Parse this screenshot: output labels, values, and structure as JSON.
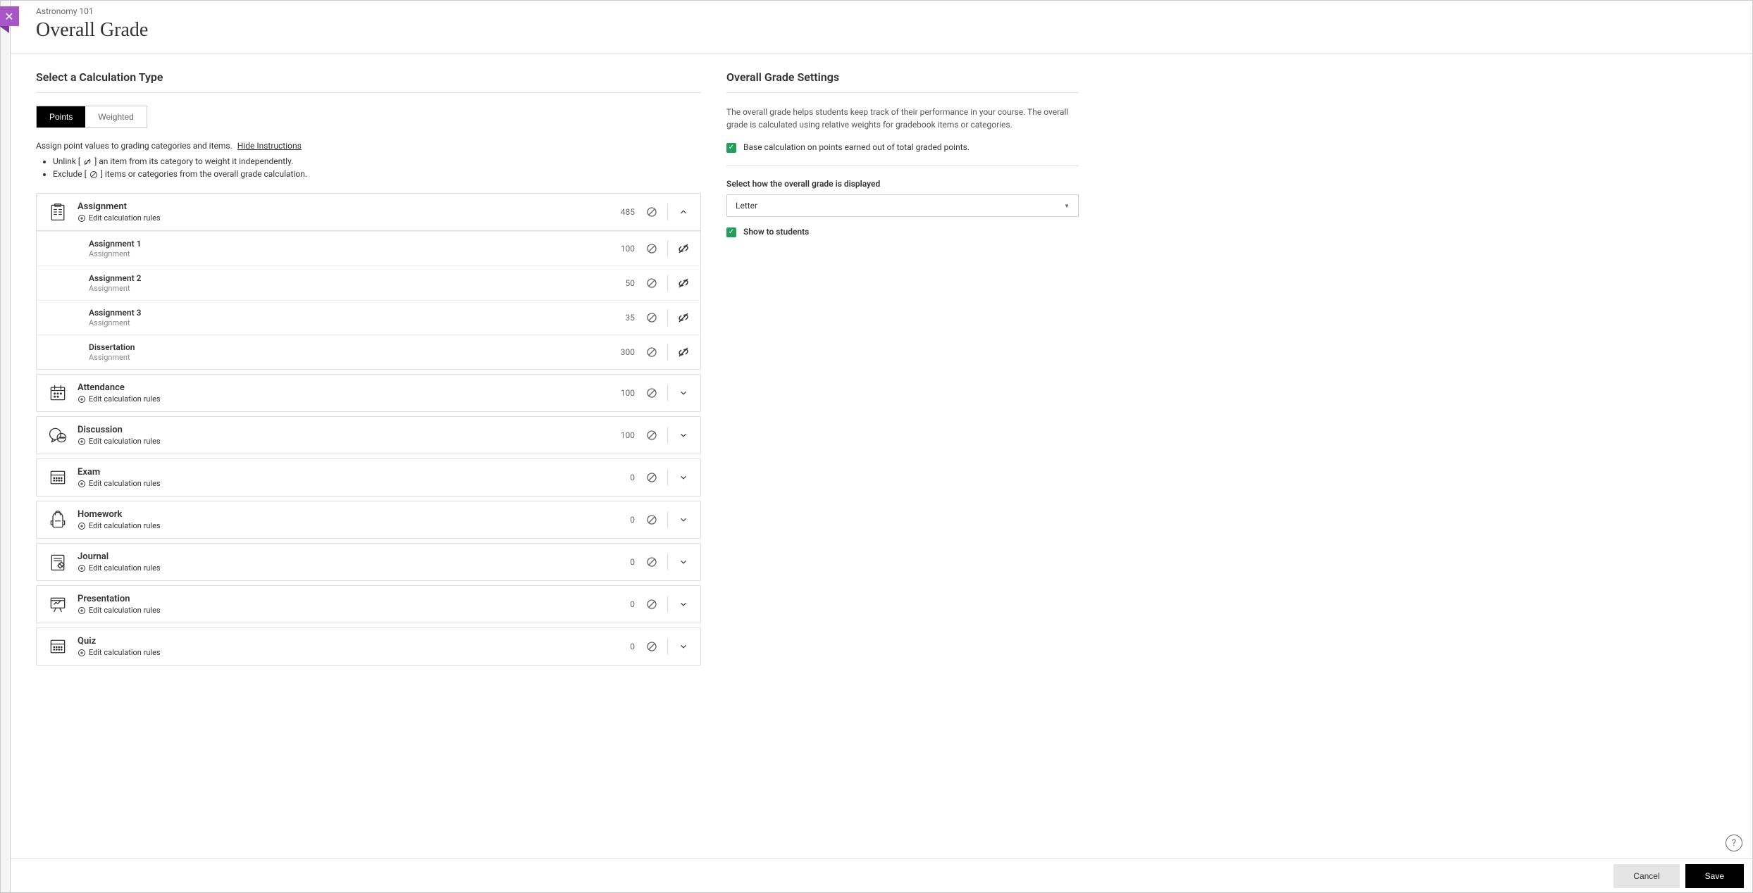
{
  "header": {
    "breadcrumb": "Astronomy 101",
    "title": "Overall Grade"
  },
  "calculation": {
    "section_title": "Select a Calculation Type",
    "tabs": {
      "points": "Points",
      "weighted": "Weighted"
    },
    "instructions_lead": "Assign point values to grading categories and items.",
    "hide_instructions": "Hide Instructions",
    "bullets": {
      "b1_pre": "Unlink [",
      "b1_post": "] an item from its category to weight it independently.",
      "b2_pre": "Exclude [",
      "b2_post": "] items or categories from the overall grade calculation."
    },
    "edit_rules_label": "Edit calculation rules"
  },
  "categories": [
    {
      "name": "Assignment",
      "points": "485",
      "expanded": true,
      "icon": "clipboard",
      "items": [
        {
          "name": "Assignment 1",
          "sub": "Assignment",
          "points": "100"
        },
        {
          "name": "Assignment 2",
          "sub": "Assignment",
          "points": "50"
        },
        {
          "name": "Assignment 3",
          "sub": "Assignment",
          "points": "35"
        },
        {
          "name": "Dissertation",
          "sub": "Assignment",
          "points": "300"
        }
      ]
    },
    {
      "name": "Attendance",
      "points": "100",
      "expanded": false,
      "icon": "calendar"
    },
    {
      "name": "Discussion",
      "points": "100",
      "expanded": false,
      "icon": "chat"
    },
    {
      "name": "Exam",
      "points": "0",
      "expanded": false,
      "icon": "grid"
    },
    {
      "name": "Homework",
      "points": "0",
      "expanded": false,
      "icon": "backpack"
    },
    {
      "name": "Journal",
      "points": "0",
      "expanded": false,
      "icon": "journal"
    },
    {
      "name": "Presentation",
      "points": "0",
      "expanded": false,
      "icon": "presentation"
    },
    {
      "name": "Quiz",
      "points": "0",
      "expanded": false,
      "icon": "grid"
    }
  ],
  "settings": {
    "section_title": "Overall Grade Settings",
    "description": "The overall grade helps students keep track of their performance in your course. The overall grade is calculated using relative weights for gradebook items or categories.",
    "base_calc_label": "Base calculation on points earned out of total graded points.",
    "display_label": "Select how the overall grade is displayed",
    "display_value": "Letter",
    "show_students_label": "Show to students"
  },
  "footer": {
    "cancel": "Cancel",
    "save": "Save"
  },
  "help_glyph": "?"
}
